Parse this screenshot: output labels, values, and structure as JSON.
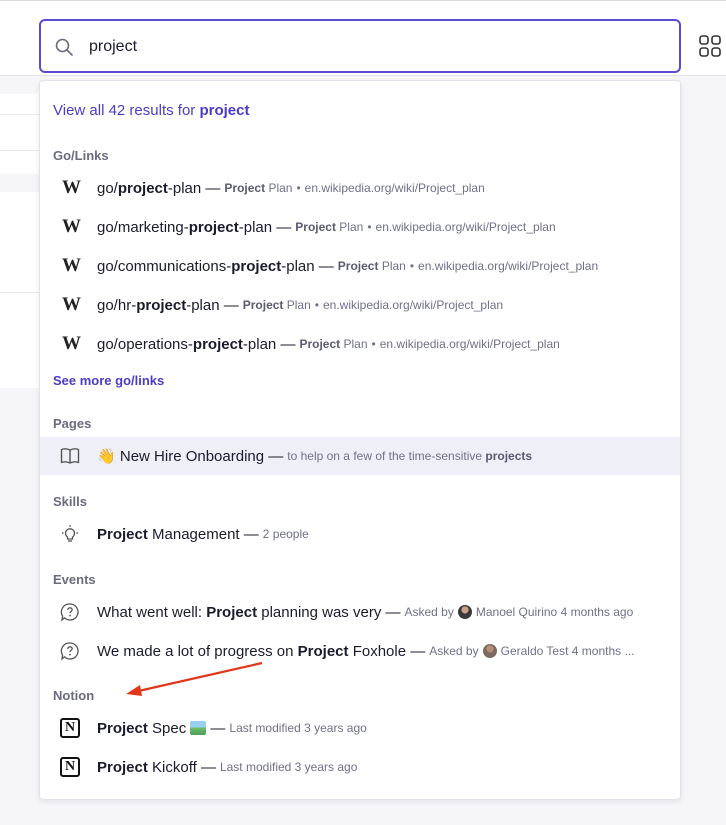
{
  "search": {
    "value": "project",
    "icon": "search-icon"
  },
  "apps_icon": "grid-apps-icon",
  "dropdown": {
    "view_all": {
      "prefix": "View all 42 results for",
      "query": "project"
    },
    "sections": {
      "golinks": {
        "heading": "Go/Links",
        "items": [
          {
            "pre": "go/",
            "bold": "project",
            "post": "-plan —",
            "meta_bold": "Project",
            "meta": "Plan",
            "url": "en.wikipedia.org/wiki/Project_plan"
          },
          {
            "pre": "go/marketing-",
            "bold": "project",
            "post": "-plan —",
            "meta_bold": "Project",
            "meta": "Plan",
            "url": "en.wikipedia.org/wiki/Project_plan"
          },
          {
            "pre": "go/communications-",
            "bold": "project",
            "post": "-plan —",
            "meta_bold": "Project",
            "meta": "Plan",
            "url": "en.wikipedia.org/wiki/Project_plan"
          },
          {
            "pre": "go/hr-",
            "bold": "project",
            "post": "-plan —",
            "meta_bold": "Project",
            "meta": "Plan",
            "url": "en.wikipedia.org/wiki/Project_plan"
          },
          {
            "pre": "go/operations-",
            "bold": "project",
            "post": "-plan —",
            "meta_bold": "Project",
            "meta": "Plan",
            "url": "en.wikipedia.org/wiki/Project_plan"
          }
        ],
        "see_more": "See more go/links"
      },
      "pages": {
        "heading": "Pages",
        "items": [
          {
            "emoji": "👋",
            "title": "New Hire Onboarding —",
            "meta": "to help on a few of the time-sensitive",
            "meta_bold": "projects"
          }
        ]
      },
      "skills": {
        "heading": "Skills",
        "items": [
          {
            "bold": "Project",
            "rest": "Management —",
            "meta": "2 people"
          }
        ]
      },
      "events": {
        "heading": "Events",
        "items": [
          {
            "pre": "What went well:",
            "bold": "Project",
            "post": "planning was very —",
            "meta_prefix": "Asked by",
            "person": "Manoel Quirino",
            "time": "4 months ago"
          },
          {
            "pre": "We made a lot of progress on",
            "bold": "Project",
            "post": "Foxhole —",
            "meta_prefix": "Asked by",
            "person": "Geraldo Test",
            "time": "4 months ..."
          }
        ]
      },
      "notion": {
        "heading": "Notion",
        "items": [
          {
            "bold": "Project",
            "rest": "Spec",
            "meta": "Last modified 3 years ago"
          },
          {
            "bold": "Project",
            "rest": "Kickoff —",
            "meta": "Last modified 3 years ago"
          }
        ]
      }
    }
  },
  "colors": {
    "accent": "#5b4bd0",
    "link": "#4b3cc4",
    "highlight_row": "#efeff7",
    "annotation_arrow": "#e0361a"
  }
}
